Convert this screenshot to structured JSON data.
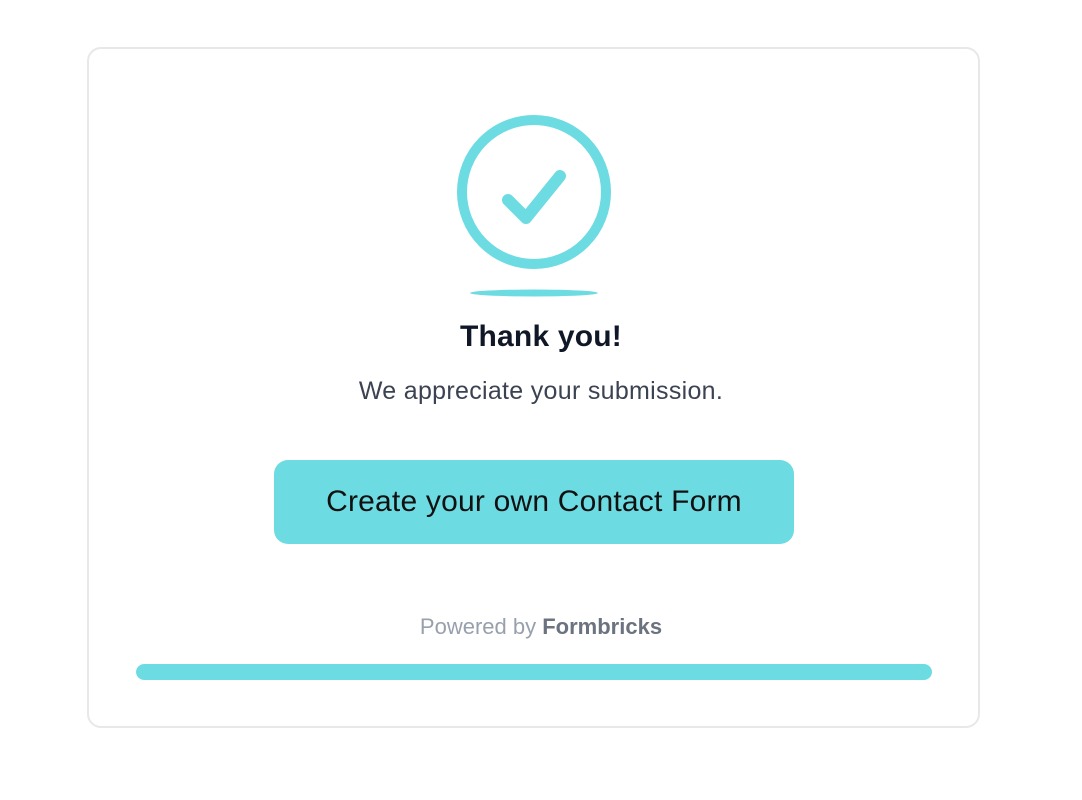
{
  "completion": {
    "icon": "check-circle-icon",
    "title": "Thank you!",
    "subtitle": "We appreciate your submission."
  },
  "cta": {
    "label": "Create your own Contact Form"
  },
  "footer": {
    "powered_prefix": "Powered by",
    "brand_name": "Formbricks"
  },
  "progress": {
    "fraction": 1.0
  },
  "colors": {
    "accent": "#6ddbe2",
    "title": "#101828",
    "subtitle": "#3b4252",
    "muted": "#98a0ad",
    "card_border": "#e8e8ea"
  }
}
